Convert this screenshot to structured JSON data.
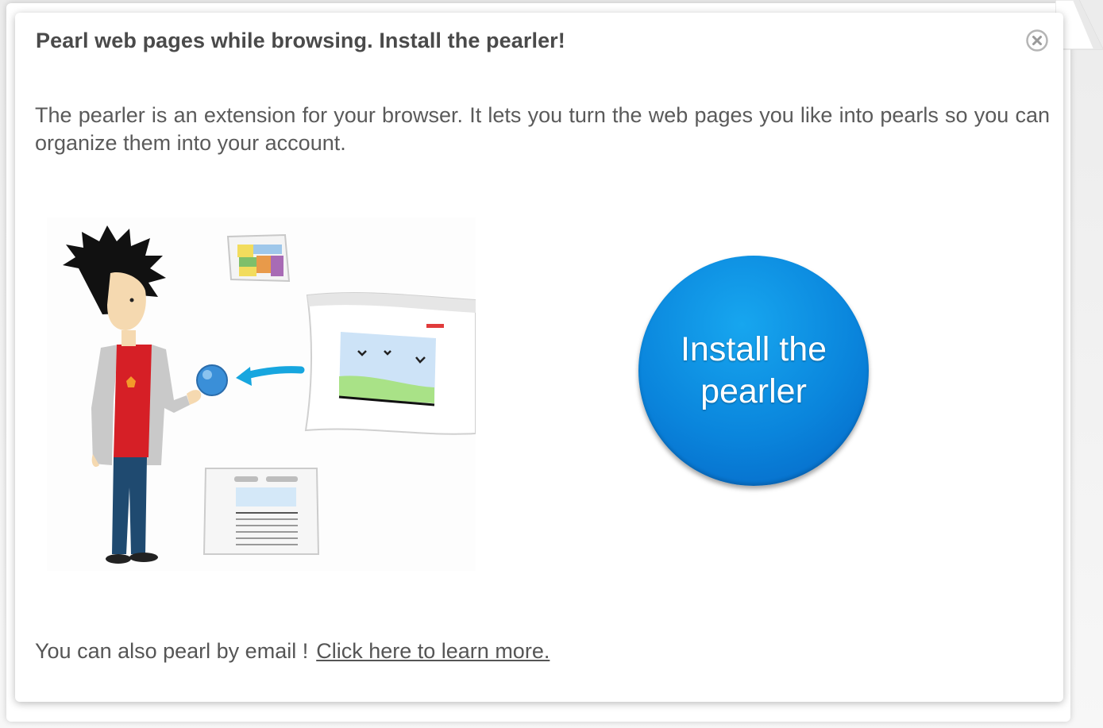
{
  "dialog": {
    "title": "Pearl web pages while browsing. Install the pearler!",
    "description": "The pearler is an extension for your browser. It lets you turn the web pages you like into pearls so you can organize them into your account.",
    "install_button": "Install the pearler",
    "footer_text": "You can also pearl by email !",
    "footer_link": "Click here to learn more.",
    "close_icon": "close-icon",
    "colors": {
      "install_button": "#0a85dc",
      "title": "#4a4a4a",
      "text": "#5a5a5a"
    }
  }
}
